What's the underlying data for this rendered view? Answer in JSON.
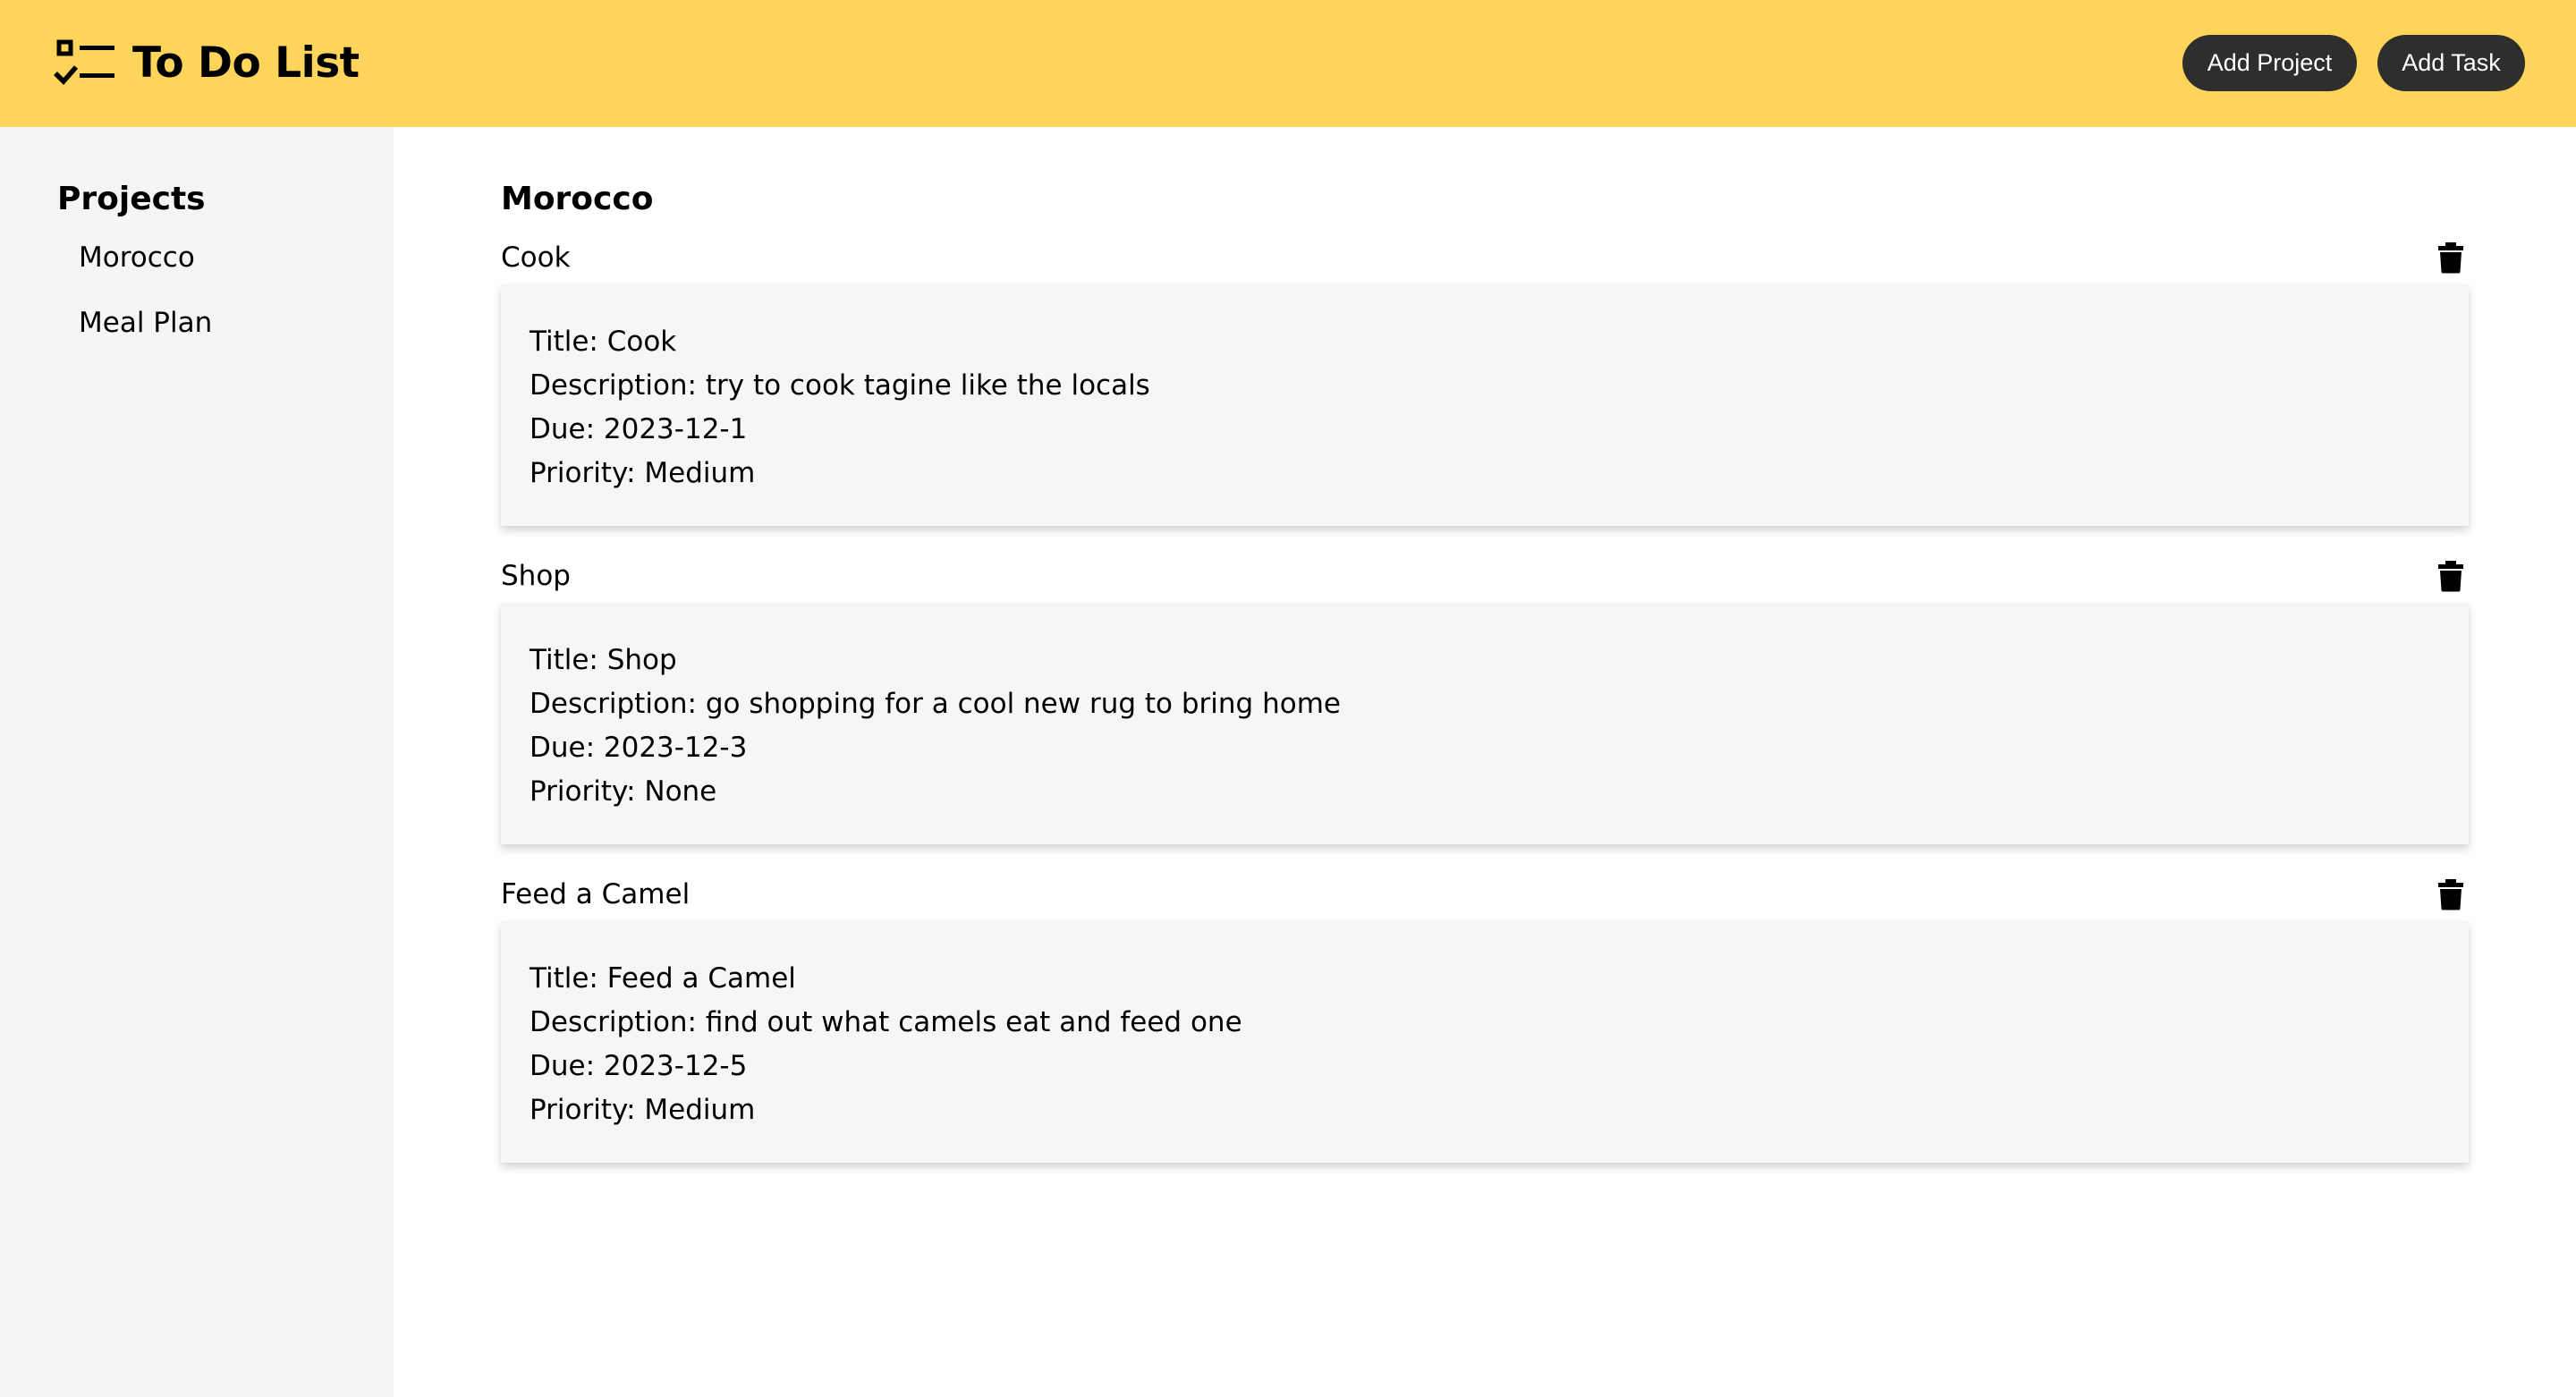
{
  "header": {
    "app_title": "To Do List",
    "logo_icon": "checklist-icon",
    "add_project_label": "Add Project",
    "add_task_label": "Add Task",
    "background_color": "#ffd45a",
    "button_color": "#2e2e2c"
  },
  "sidebar": {
    "heading": "Projects",
    "items": [
      {
        "label": "Morocco"
      },
      {
        "label": "Meal Plan"
      }
    ]
  },
  "main": {
    "project_title": "Morocco",
    "tasks": [
      {
        "name": "Cook",
        "title_line": "Title: Cook",
        "description_line": "Description: try to cook tagine like the locals",
        "due_line": "Due: 2023-12-1",
        "priority_line": "Priority: Medium"
      },
      {
        "name": "Shop",
        "title_line": "Title: Shop",
        "description_line": "Description: go shopping for a cool new rug to bring home",
        "due_line": "Due: 2023-12-3",
        "priority_line": "Priority: None"
      },
      {
        "name": "Feed a Camel",
        "title_line": "Title: Feed a Camel",
        "description_line": "Description: find out what camels eat and feed one",
        "due_line": "Due: 2023-12-5",
        "priority_line": "Priority: Medium"
      }
    ]
  }
}
